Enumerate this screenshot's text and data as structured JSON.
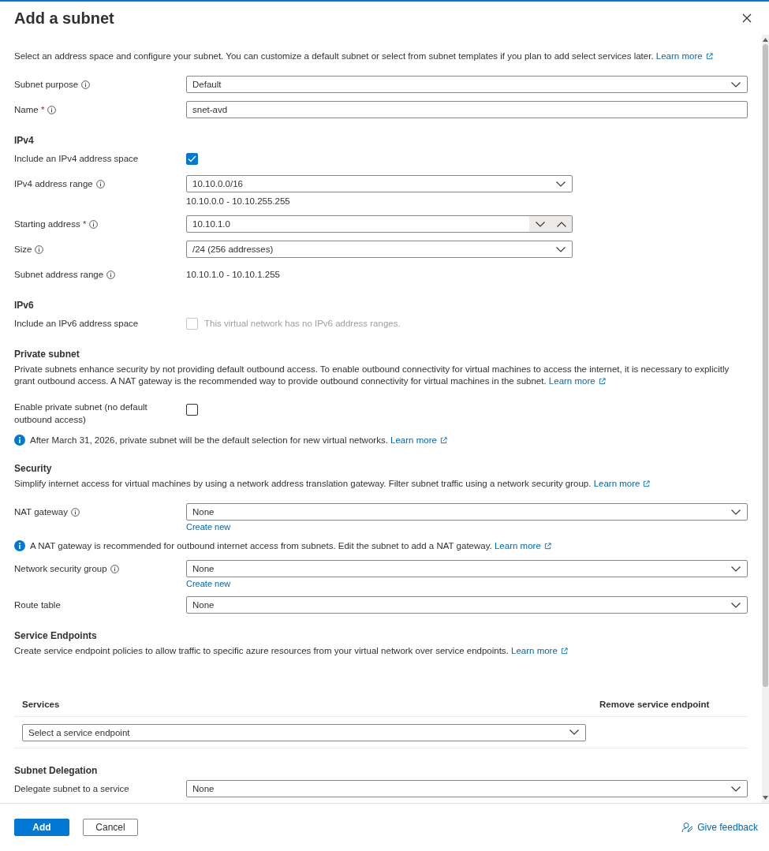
{
  "panel": {
    "title": "Add a subnet"
  },
  "blocks": [
    {
      "kind": "paragraph",
      "text": "Select an address space and configure your subnet. You can customize a default subnet or select from subnet templates if you plan to add select services later.",
      "link": "Learn more"
    },
    {
      "kind": "select",
      "label": "Subnet purpose",
      "info_icon": true,
      "value": "Default"
    },
    {
      "kind": "text",
      "label": "Name",
      "required_mark": "*",
      "info_icon": true,
      "value": "snet-avd"
    },
    {
      "kind": "heading",
      "text": "IPv4"
    },
    {
      "kind": "checkbox",
      "label": "Include an IPv4 address space",
      "checked": true,
      "disabled": false
    },
    {
      "kind": "select",
      "label": "IPv4 address range",
      "info_icon": true,
      "value": "10.10.0.0/16",
      "helper": "10.10.0.0 - 10.10.255.255"
    },
    {
      "kind": "spin",
      "label": "Starting address",
      "required_mark": "*",
      "info_icon": true,
      "value": "10.10.1.0"
    },
    {
      "kind": "select",
      "label": "Size",
      "info_icon": true,
      "value": "/24 (256 addresses)"
    },
    {
      "kind": "static",
      "label": "Subnet address range",
      "info_icon": true,
      "value": "10.10.1.0 - 10.10.1.255"
    },
    {
      "kind": "heading",
      "text": "IPv6"
    },
    {
      "kind": "checkbox",
      "label": "Include an IPv6 address space",
      "checked": false,
      "disabled": true,
      "note": "This virtual network has no IPv6 address ranges."
    },
    {
      "kind": "heading",
      "text": "Private subnet"
    },
    {
      "kind": "paragraph",
      "text": "Private subnets enhance security by not providing default outbound access. To enable outbound connectivity for virtual machines to access the internet, it is necessary to explicitly grant outbound access. A NAT gateway is the recommended way to provide outbound connectivity for virtual machines in the subnet.",
      "link": "Learn more"
    },
    {
      "kind": "checkbox",
      "label": "Enable private subnet (no default outbound access)",
      "checked": false,
      "disabled": false
    },
    {
      "kind": "info",
      "text": "After March 31, 2026, private subnet will be the default selection for new virtual networks.",
      "link": "Learn more"
    },
    {
      "kind": "heading",
      "text": "Security"
    },
    {
      "kind": "paragraph",
      "text": "Simplify internet access for virtual machines by using a network address translation gateway. Filter subnet traffic using a network security group.",
      "link": "Learn more"
    },
    {
      "kind": "select",
      "label": "NAT gateway",
      "info_icon": true,
      "value": "None",
      "create_link": "Create new"
    },
    {
      "kind": "info",
      "text": "A NAT gateway is recommended for outbound internet access from subnets. Edit the subnet to add a NAT gateway.",
      "link": "Learn more"
    },
    {
      "kind": "select",
      "label": "Network security group",
      "info_icon": true,
      "value": "None",
      "create_link": "Create new"
    },
    {
      "kind": "select",
      "label": "Route table",
      "info_icon": false,
      "value": "None"
    },
    {
      "kind": "heading",
      "text": "Service Endpoints"
    },
    {
      "kind": "paragraph",
      "text": "Create service endpoint policies to allow traffic to specific azure resources from your virtual network over service endpoints.",
      "link": "Learn more"
    },
    {
      "kind": "table",
      "columns": [
        "Services",
        "Remove service endpoint"
      ],
      "rows": [
        {
          "placeholder": "Select a service endpoint"
        }
      ]
    },
    {
      "kind": "heading",
      "text": "Subnet Delegation"
    },
    {
      "kind": "select",
      "label": "Delegate subnet to a service",
      "info_icon": false,
      "value": "None"
    }
  ],
  "footer": {
    "buttons": [
      {
        "label": "Add",
        "kind": "primary"
      },
      {
        "label": "Cancel",
        "kind": "secondary"
      }
    ],
    "feedback": "Give feedback"
  }
}
